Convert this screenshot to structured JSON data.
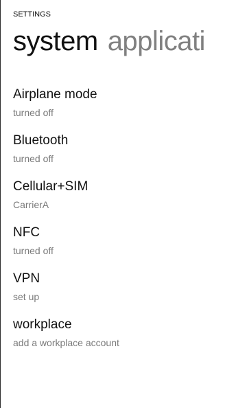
{
  "app": {
    "title": "SETTINGS"
  },
  "pivot": {
    "items": [
      {
        "label": "system",
        "active": true
      },
      {
        "label": "applicati",
        "active": false
      }
    ]
  },
  "settings": [
    {
      "title": "Airplane mode",
      "status": "turned off"
    },
    {
      "title": "Bluetooth",
      "status": "turned off"
    },
    {
      "title": "Cellular+SIM",
      "status": "CarrierA"
    },
    {
      "title": "NFC",
      "status": "turned off"
    },
    {
      "title": "VPN",
      "status": "set up"
    },
    {
      "title": "workplace",
      "status": "add a workplace account"
    }
  ],
  "colors": {
    "primary_text": "#111111",
    "secondary_text": "#7a7a7a",
    "inactive_pivot": "#808080",
    "background": "#ffffff"
  }
}
